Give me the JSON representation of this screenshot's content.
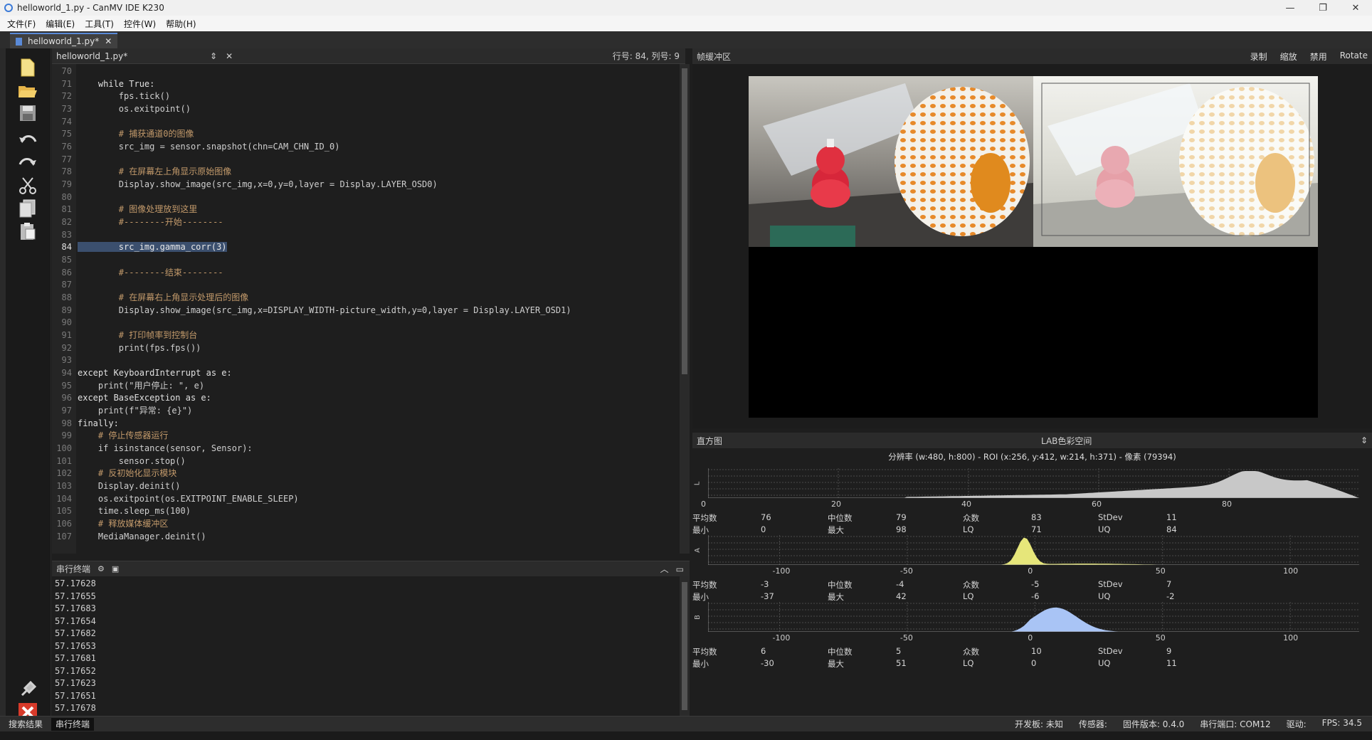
{
  "window": {
    "title": "helloworld_1.py - CanMV IDE K230"
  },
  "menu": [
    "文件(F)",
    "编辑(E)",
    "工具(T)",
    "控件(W)",
    "帮助(H)"
  ],
  "doc_tab": {
    "label": "helloworld_1.py*"
  },
  "editor": {
    "file_label": "helloworld_1.py*",
    "cursor_position": "行号: 84, 列号: 9",
    "current_line": 84,
    "lines": [
      {
        "n": "70",
        "t": "",
        "k": ""
      },
      {
        "n": "71",
        "t": "    while True:",
        "k": "kw"
      },
      {
        "n": "72",
        "t": "        fps.tick()",
        "k": ""
      },
      {
        "n": "73",
        "t": "        os.exitpoint()",
        "k": ""
      },
      {
        "n": "74",
        "t": "",
        "k": ""
      },
      {
        "n": "75",
        "t": "        # 捕获通道0的图像",
        "k": "cm"
      },
      {
        "n": "76",
        "t": "        src_img = sensor.snapshot(chn=CAM_CHN_ID_0)",
        "k": ""
      },
      {
        "n": "77",
        "t": "",
        "k": ""
      },
      {
        "n": "78",
        "t": "        # 在屏幕左上角显示原始图像",
        "k": "cm"
      },
      {
        "n": "79",
        "t": "        Display.show_image(src_img,x=0,y=0,layer = Display.LAYER_OSD0)",
        "k": ""
      },
      {
        "n": "80",
        "t": "",
        "k": ""
      },
      {
        "n": "81",
        "t": "        # 图像处理放到这里",
        "k": "cm"
      },
      {
        "n": "82",
        "t": "        #--------开始--------",
        "k": "cm"
      },
      {
        "n": "83",
        "t": "",
        "k": ""
      },
      {
        "n": "84",
        "t": "        src_img.gamma_corr(3)",
        "k": "sel"
      },
      {
        "n": "85",
        "t": "",
        "k": ""
      },
      {
        "n": "86",
        "t": "        #--------结束--------",
        "k": "cm"
      },
      {
        "n": "87",
        "t": "",
        "k": ""
      },
      {
        "n": "88",
        "t": "        # 在屏幕右上角显示处理后的图像",
        "k": "cm"
      },
      {
        "n": "89",
        "t": "        Display.show_image(src_img,x=DISPLAY_WIDTH-picture_width,y=0,layer = Display.LAYER_OSD1)",
        "k": ""
      },
      {
        "n": "90",
        "t": "",
        "k": ""
      },
      {
        "n": "91",
        "t": "        # 打印帧率到控制台",
        "k": "cm"
      },
      {
        "n": "92",
        "t": "        print(fps.fps())",
        "k": ""
      },
      {
        "n": "93",
        "t": "",
        "k": ""
      },
      {
        "n": "94",
        "t": "except KeyboardInterrupt as e:",
        "k": "kw"
      },
      {
        "n": "95",
        "t": "    print(\"用户停止: \", e)",
        "k": ""
      },
      {
        "n": "96",
        "t": "except BaseException as e:",
        "k": "kw"
      },
      {
        "n": "97",
        "t": "    print(f\"异常: {e}\")",
        "k": ""
      },
      {
        "n": "98",
        "t": "finally:",
        "k": "kw"
      },
      {
        "n": "99",
        "t": "    # 停止传感器运行",
        "k": "cm"
      },
      {
        "n": "100",
        "t": "    if isinstance(sensor, Sensor):",
        "k": ""
      },
      {
        "n": "101",
        "t": "        sensor.stop()",
        "k": ""
      },
      {
        "n": "102",
        "t": "    # 反初始化显示模块",
        "k": "cm"
      },
      {
        "n": "103",
        "t": "    Display.deinit()",
        "k": ""
      },
      {
        "n": "104",
        "t": "    os.exitpoint(os.EXITPOINT_ENABLE_SLEEP)",
        "k": ""
      },
      {
        "n": "105",
        "t": "    time.sleep_ms(100)",
        "k": ""
      },
      {
        "n": "106",
        "t": "    # 释放媒体缓冲区",
        "k": "cm"
      },
      {
        "n": "107",
        "t": "    MediaManager.deinit()",
        "k": ""
      }
    ]
  },
  "terminal": {
    "title": "串行终端",
    "lines": [
      "57.17628",
      "57.17655",
      "57.17683",
      "57.17654",
      "57.17682",
      "57.17653",
      "57.17681",
      "57.17652",
      "57.17623",
      "57.17651",
      "57.17678"
    ]
  },
  "status": {
    "tabs": [
      "搜索结果",
      "串行终端"
    ],
    "board": "开发板: 未知",
    "sensor": "传感器:",
    "firmware": "固件版本: 0.4.0",
    "port": "串行端口: COM12",
    "driver": "驱动:",
    "fps": "FPS:  34.5"
  },
  "framebuffer": {
    "title": "帧缓冲区",
    "buttons": [
      "录制",
      "缩放",
      "禁用",
      "Rotate"
    ]
  },
  "histogram": {
    "title": "直方图",
    "color_space": "LAB色彩空间",
    "info": "分辨率 (w:480, h:800) - ROI (x:256, y:412, w:214, h:371) - 像素 (79394)",
    "channels": [
      {
        "name": "L",
        "color": "#c8c8c8",
        "range": [
          0,
          100
        ],
        "ticks": [
          "0",
          "20",
          "40",
          "60",
          "80"
        ],
        "stats": {
          "mean": "76",
          "median": "79",
          "mode": "83",
          "stdev": "11",
          "min": "0",
          "max": "98",
          "lq": "71",
          "uq": "84"
        }
      },
      {
        "name": "A",
        "color": "#e6e67a",
        "range": [
          -128,
          127
        ],
        "ticks": [
          "-100",
          "-50",
          "0",
          "50",
          "100"
        ],
        "stats": {
          "mean": "-3",
          "median": "-4",
          "mode": "-5",
          "stdev": "7",
          "min": "-37",
          "max": "42",
          "lq": "-6",
          "uq": "-2"
        }
      },
      {
        "name": "B",
        "color": "#a9c4f5",
        "range": [
          -128,
          127
        ],
        "ticks": [
          "-100",
          "-50",
          "0",
          "50",
          "100"
        ],
        "stats": {
          "mean": "6",
          "median": "5",
          "mode": "10",
          "stdev": "9",
          "min": "-30",
          "max": "51",
          "lq": "0",
          "uq": "11"
        }
      }
    ],
    "labels": {
      "mean": "平均数",
      "median": "中位数",
      "mode": "众数",
      "stdev": "StDev",
      "min": "最小",
      "max": "最大",
      "lq": "LQ",
      "uq": "UQ"
    }
  }
}
